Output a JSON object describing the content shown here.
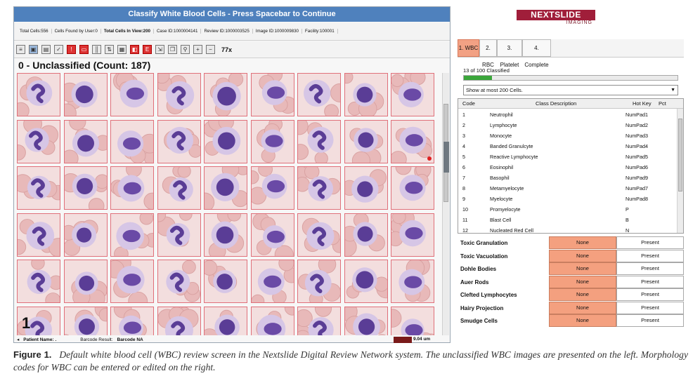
{
  "left": {
    "title": "Classify White Blood Cells - Press Spacebar to Continue",
    "info": {
      "total_cells": "Total Cells:556",
      "cells_found": "Cells Found by User:0",
      "total_in_view": "Total Cells In View:200",
      "case_id": "Case ID:1000004141",
      "review_id": "Review ID:1000003525",
      "image_id": "Image ID:1000009830",
      "facility": "Facility:100001"
    },
    "toolbar_zoom": "77x",
    "group_header": "0 - Unclassified (Count: 187)",
    "page_number": "1",
    "status": {
      "patient_label": "Patient Name:",
      "patient_value": ".",
      "barcode_label": "Barcode Result:",
      "barcode_value": "Barcode NA",
      "scale": "9.04 um"
    }
  },
  "right": {
    "logo_brand": "NEXTSLIDE",
    "logo_sub": "IMAGING",
    "tabs": [
      "1. WBC",
      "2. RBC",
      "3. Platelet",
      "4. Complete"
    ],
    "progress_text": "13 of 100 Classified",
    "progress_fraction": 0.13,
    "show_select": "Show at most 200 Cells.",
    "table_headers": {
      "code": "Code",
      "desc": "Class Description",
      "hotkey": "Hot Key",
      "pct": "Pct"
    },
    "rows": [
      {
        "code": "1",
        "desc": "Neutrophil",
        "hotkey": "NumPad1"
      },
      {
        "code": "2",
        "desc": "Lymphocyte",
        "hotkey": "NumPad2"
      },
      {
        "code": "3",
        "desc": "Monocyte",
        "hotkey": "NumPad3"
      },
      {
        "code": "4",
        "desc": "Banded Granulcyte",
        "hotkey": "NumPad4"
      },
      {
        "code": "5",
        "desc": "Reactive Lymphocyte",
        "hotkey": "NumPad5"
      },
      {
        "code": "6",
        "desc": "Eosinophil",
        "hotkey": "NumPad6"
      },
      {
        "code": "7",
        "desc": "Basophil",
        "hotkey": "NumPad9"
      },
      {
        "code": "8",
        "desc": "Metamyelocyte",
        "hotkey": "NumPad7"
      },
      {
        "code": "9",
        "desc": "Myelocyte",
        "hotkey": "NumPad8"
      },
      {
        "code": "10",
        "desc": "Promyelocyte",
        "hotkey": "P"
      },
      {
        "code": "11",
        "desc": "Blast Cell",
        "hotkey": "B"
      },
      {
        "code": "12",
        "desc": "Nucleated Red Cell",
        "hotkey": "N"
      }
    ],
    "morphology": [
      {
        "label": "Toxic Granulation",
        "none": "None",
        "present": "Present"
      },
      {
        "label": "Toxic Vacuolation",
        "none": "None",
        "present": "Present"
      },
      {
        "label": "Dohle Bodies",
        "none": "None",
        "present": "Present"
      },
      {
        "label": "Auer Rods",
        "none": "None",
        "present": "Present"
      },
      {
        "label": "Clefted Lymphocytes",
        "none": "None",
        "present": "Present"
      },
      {
        "label": "Hairy Projection",
        "none": "None",
        "present": "Present"
      },
      {
        "label": "Smudge Cells",
        "none": "None",
        "present": "Present"
      }
    ]
  },
  "caption": {
    "label": "Figure 1.",
    "text": "Default white blood cell (WBC) review screen in the Nextslide Digital Review Network system. The unclassified WBC images are presented on the left. Morphology codes for WBC can be entered or edited on the right."
  },
  "colors": {
    "title_bar": "#4f81bd",
    "cell_border": "#e0707a",
    "active_tab": "#f2a184",
    "none_button": "#f4a07f",
    "progress_fill": "#3aa63a",
    "brand": "#a01e3a"
  },
  "icons": [
    "list-icon",
    "image-icon",
    "report-icon",
    "check-icon",
    "alert-icon",
    "text-icon",
    "barcode-icon",
    "sort-icon",
    "stack-icon",
    "layers-icon",
    "edit-icon",
    "export-icon",
    "copy-icon",
    "search-icon",
    "add-icon",
    "remove-icon"
  ]
}
